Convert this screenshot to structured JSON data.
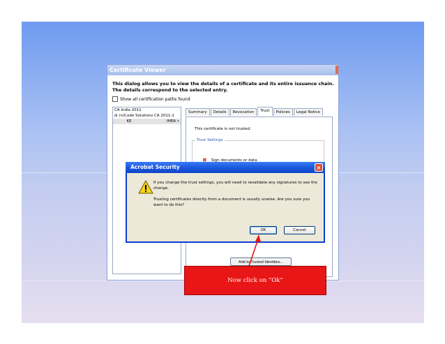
{
  "cert_viewer": {
    "title": "Certificate Viewer",
    "description": "This dialog allows you to view the details of a certificate and its entire issuance chain. The details correspond to the selected entry.",
    "show_all_label": "Show all certification paths found",
    "tree": [
      {
        "label": "CA India 2011",
        "extra": ""
      },
      {
        "label": "⊟ (n)Code Solutions CA 2011-1",
        "extra": ""
      },
      {
        "label": "          KE",
        "extra": "IHEA •"
      }
    ],
    "tabs": [
      "Summary",
      "Details",
      "Revocation",
      "Trust",
      "Policies",
      "Legal Notice"
    ],
    "active_tab": "Trust",
    "trust_status": "This certificate is not trusted.",
    "trust_settings_label": "Trust Settings",
    "sign_label": "Sign documents or data",
    "add_trusted_label": "Add to Trusted Identities..."
  },
  "security_dialog": {
    "title": "Acrobat Security",
    "message1": "If you change the trust settings, you will need to revalidate any signatures to see the change.",
    "message2": "Trusting certificates directly from a document is usually unwise. Are you sure you want to do this?",
    "ok_label": "OK",
    "cancel_label": "Cancel",
    "close_symbol": "×"
  },
  "callout": {
    "text": "Now click on “Ok”",
    "color": "#e81616"
  },
  "icons": {
    "warning": "warning-icon",
    "close": "close-icon",
    "not_trusted": "x-mark-icon"
  }
}
